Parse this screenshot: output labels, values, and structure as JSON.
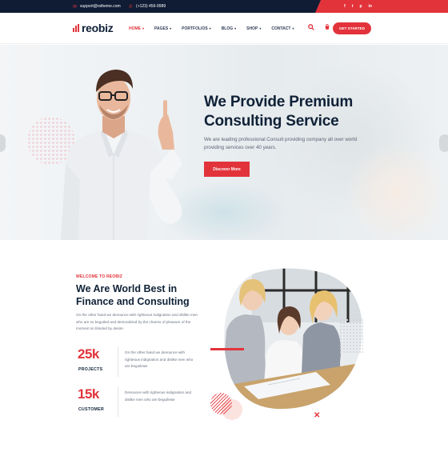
{
  "topbar": {
    "email": "support@rstheme.com",
    "phone": "(+123) 456-9989",
    "socials": [
      "f",
      "t",
      "p",
      "in"
    ]
  },
  "header": {
    "logo_text": "reobiz",
    "nav": [
      {
        "label": "HOME",
        "active": true
      },
      {
        "label": "PAGES",
        "active": false
      },
      {
        "label": "PORTFOLIOS",
        "active": false
      },
      {
        "label": "BLOG",
        "active": false
      },
      {
        "label": "SHOP",
        "active": false
      },
      {
        "label": "CONTACT",
        "active": false
      }
    ],
    "cta": "GET STARTED"
  },
  "hero": {
    "title_line1": "We Provide Premium",
    "title_line2": "Consulting Service",
    "description": "We are leading professional Consult providing company all over world providing services over 40 years.",
    "button": "Discover More"
  },
  "about": {
    "kicker": "WELCOME TO REOBIZ",
    "title": "We Are World Best in Finance and Consulting",
    "text": "On the other hand we denounce with righteous indignation and dislike men who are so beguiled and demoralized by the charms of pleasure of the moment so blinded by desire.",
    "stats": [
      {
        "number": "25k",
        "label": "PROJECTS",
        "text": "On the other hand we denounce with righteous indignation and dislike men who are beguilesie"
      },
      {
        "number": "15k",
        "label": "CUSTOMER",
        "text": "Denounce with righteous indignation and dislike men who are beguilesie"
      }
    ]
  },
  "colors": {
    "accent": "#e2333b",
    "navy": "#0f1c33",
    "heading": "#0f2137"
  }
}
